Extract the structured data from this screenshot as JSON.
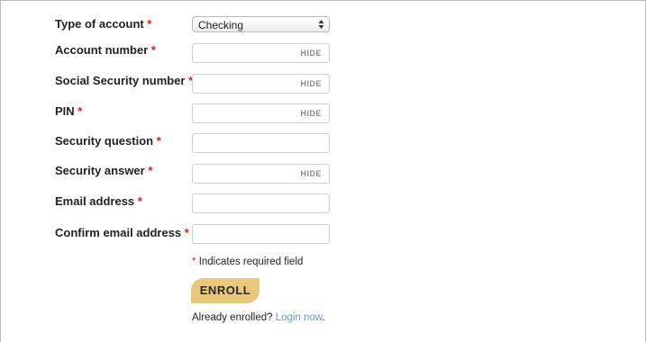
{
  "form": {
    "required_mark": "*",
    "account_type": {
      "label": "Type of account",
      "selected": "Checking"
    },
    "account_number": {
      "label": "Account number",
      "value": "",
      "hide_label": "HIDE"
    },
    "ssn": {
      "label": "Social Security number",
      "value": "",
      "hide_label": "HIDE"
    },
    "pin": {
      "label": "PIN",
      "value": "",
      "hide_label": "HIDE"
    },
    "security_question": {
      "label": "Security question",
      "value": ""
    },
    "security_answer": {
      "label": "Security answer",
      "value": "",
      "hide_label": "HIDE"
    },
    "email": {
      "label": "Email address",
      "value": ""
    },
    "confirm_email": {
      "label": "Confirm email address",
      "value": ""
    },
    "required_note": "Indicates required field",
    "enroll_label": "ENROLL",
    "already_enrolled_text": "Already enrolled?",
    "login_link": "Login now",
    "login_suffix": "."
  },
  "colors": {
    "required": "#e21b1b",
    "enroll_button": "#e8c97b",
    "link": "#6e96cc"
  }
}
